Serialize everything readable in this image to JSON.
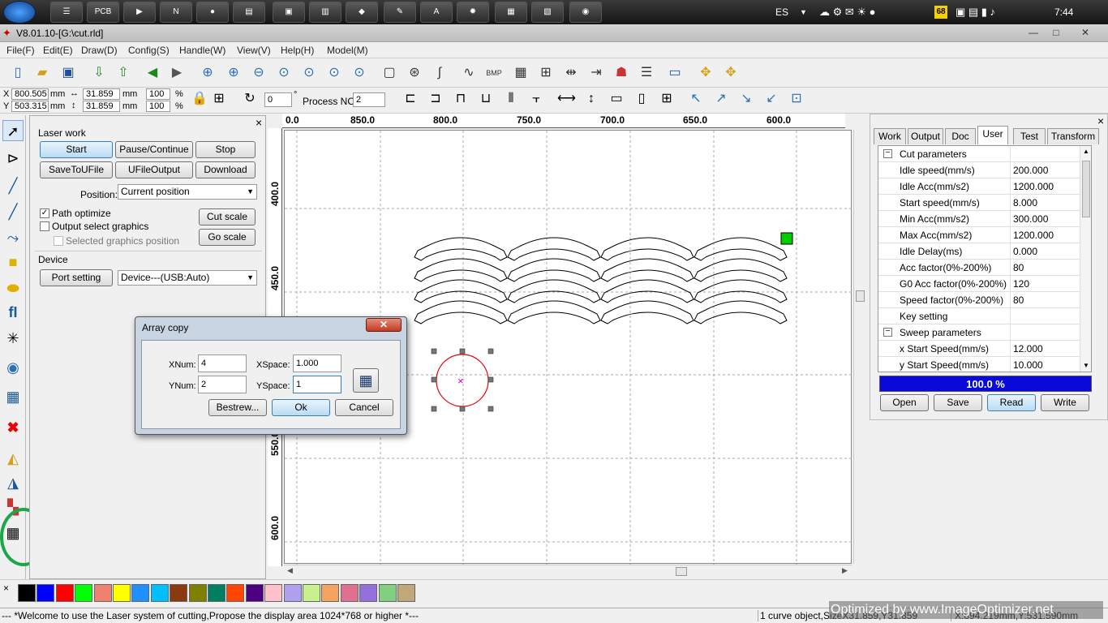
{
  "taskbar": {
    "apps": [
      "☰",
      "PCB",
      "▶",
      "N",
      "●",
      "▤",
      "▣",
      "▥",
      "◆",
      "✎",
      "A",
      "✹",
      "▦",
      "▧",
      "◉"
    ],
    "lang": "ES",
    "badge": "68",
    "clock": "7:44"
  },
  "window": {
    "title": "V8.01.10-[G:\\cut.rld]",
    "minimize": "—",
    "maximize": "□",
    "close": "✕"
  },
  "menu": {
    "items": [
      "File(F)",
      "Edit(E)",
      "Draw(D)",
      "Config(S)",
      "Handle(W)",
      "View(V)",
      "Help(H)",
      "Model(M)"
    ]
  },
  "toolbar2": {
    "x_label": "X",
    "x_value": "800.505",
    "x_unit": "mm",
    "y_label": "Y",
    "y_value": "503.315",
    "y_unit": "mm",
    "w_value": "31.859",
    "w_unit": "mm",
    "h_value": "31.859",
    "h_unit": "mm",
    "wp_value": "100",
    "wp_unit": "%",
    "hp_value": "100",
    "hp_unit": "%",
    "angle_value": "0",
    "angle_unit": "°",
    "process_label": "Process NO:",
    "process_value": "2"
  },
  "laser_panel": {
    "section_title": "Laser work",
    "start": "Start",
    "pause": "Pause/Continue",
    "stop": "Stop",
    "save_to_ufile": "SaveToUFile",
    "ufile_output": "UFileOutput",
    "download": "Download",
    "position_label": "Position:",
    "position_value": "Current position",
    "path_optimize": "Path optimize",
    "output_select": "Output select graphics",
    "selected_position": "Selected graphics position",
    "cut_scale": "Cut scale",
    "go_scale": "Go scale",
    "device_title": "Device",
    "port_setting": "Port setting",
    "device_value": "Device---(USB:Auto)",
    "close": "×"
  },
  "ruler": {
    "h_labels": [
      "0.0",
      "850.0",
      "800.0",
      "750.0",
      "700.0",
      "650.0",
      "600.0"
    ],
    "v_labels": [
      "400.0",
      "450.0",
      "550.0",
      "600.0"
    ]
  },
  "right_panel": {
    "tabs": [
      "Work",
      "Output",
      "Doc",
      "User",
      "Test",
      "Transform"
    ],
    "active_tab": "User",
    "close": "×",
    "rows": [
      {
        "k": "Cut parameters",
        "v": "",
        "group": true
      },
      {
        "k": "Idle speed(mm/s)",
        "v": "200.000"
      },
      {
        "k": "Idle Acc(mm/s2)",
        "v": "1200.000"
      },
      {
        "k": "Start speed(mm/s)",
        "v": "8.000"
      },
      {
        "k": "Min Acc(mm/s2)",
        "v": "300.000"
      },
      {
        "k": "Max Acc(mm/s2)",
        "v": "1200.000"
      },
      {
        "k": "Idle Delay(ms)",
        "v": "0.000"
      },
      {
        "k": "Acc factor(0%-200%)",
        "v": "80"
      },
      {
        "k": "G0 Acc factor(0%-200%)",
        "v": "120"
      },
      {
        "k": "Speed factor(0%-200%)",
        "v": "80"
      },
      {
        "k": "Key setting",
        "v": ""
      },
      {
        "k": "Sweep parameters",
        "v": "",
        "group": true
      },
      {
        "k": "x Start Speed(mm/s)",
        "v": "12.000"
      },
      {
        "k": "y Start Speed(mm/s)",
        "v": "10.000"
      }
    ],
    "progress": 1.0,
    "progress_text": "100.0  %",
    "open": "Open",
    "save": "Save",
    "read": "Read",
    "write": "Write"
  },
  "dialog": {
    "title": "Array copy",
    "xnum_label": "XNum:",
    "xnum_value": "4",
    "ynum_label": "YNum:",
    "ynum_value": "2",
    "xspace_label": "XSpace:",
    "xspace_value": "1.000",
    "yspace_label": "YSpace:",
    "yspace_value": "1",
    "bestrew": "Bestrew...",
    "ok": "Ok",
    "cancel": "Cancel",
    "close": "✕"
  },
  "palette": {
    "close": "×",
    "colors": [
      "#000000",
      "#0000ff",
      "#ff0000",
      "#00ff00",
      "#f08070",
      "#ffff00",
      "#1e90ff",
      "#00bfff",
      "#8b3a0f",
      "#808000",
      "#008060",
      "#ff4500",
      "#4b0082",
      "#ffc0cb",
      "#b0a0f0",
      "#c8f08c",
      "#f4a460",
      "#e07090",
      "#9370db",
      "#80d080",
      "#c0a878"
    ]
  },
  "status": {
    "message": "--- *Welcome to use the Laser system of cutting,Propose the display area 1024*768 or higher *---",
    "selection": "1 curve object,SizeX31.859,Y31.859",
    "coords": "X:894.219mm,Y:531.590mm"
  },
  "watermark": "Optimized by www.ImageOptimizer.net"
}
